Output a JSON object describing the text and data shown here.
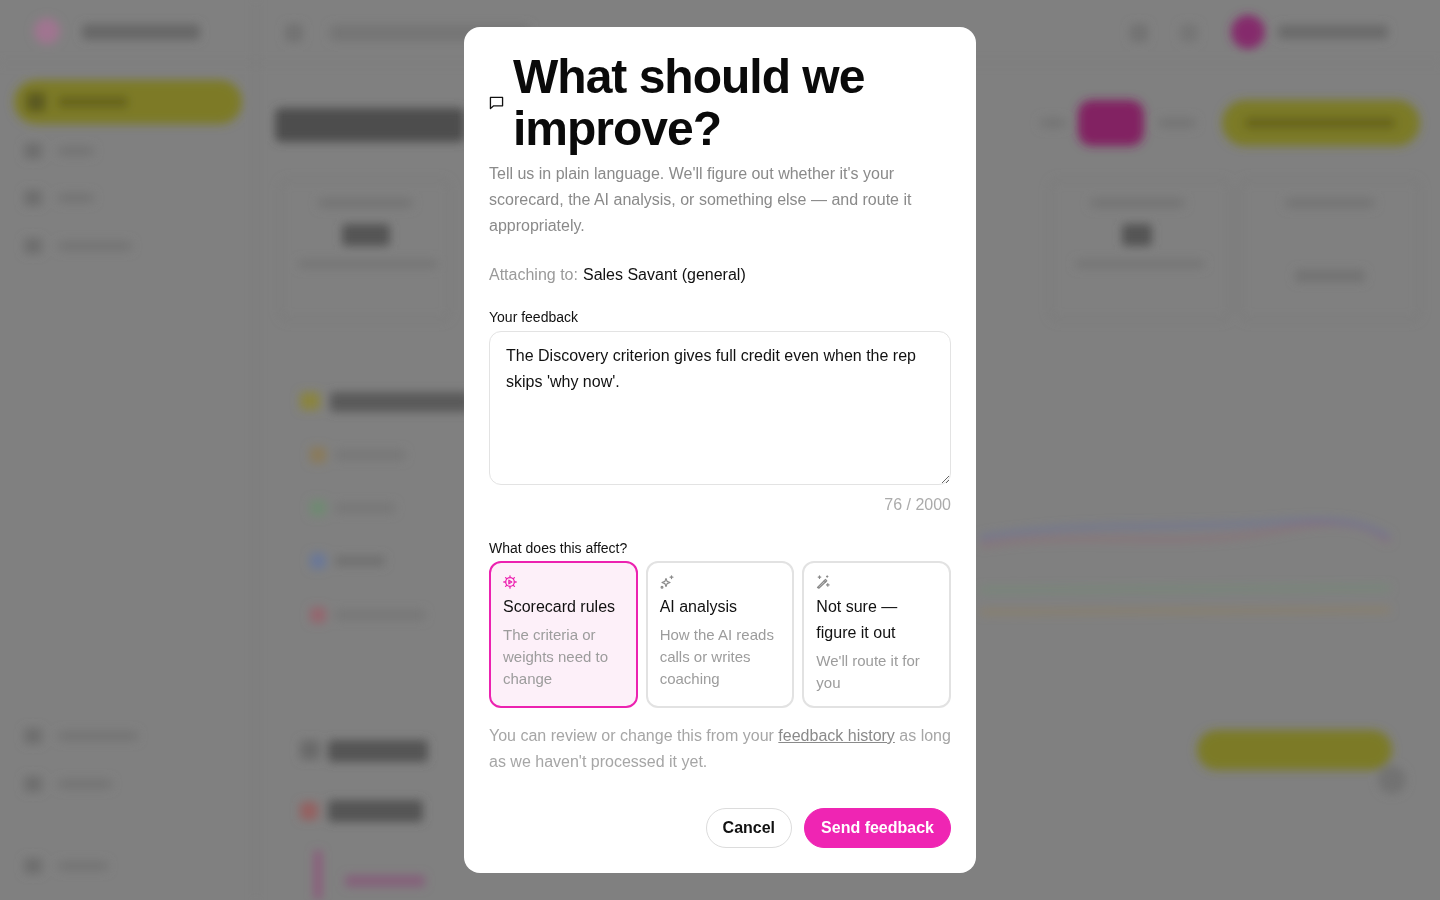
{
  "dialog": {
    "title": "What should we improve?",
    "description": "Tell us in plain language. We'll figure out whether it's your scorecard, the AI analysis, or something else — and route it appropriately.",
    "attachment": {
      "label": "Attaching to:",
      "value": "Sales Savant (general)"
    },
    "feedback_field": {
      "label": "Your feedback",
      "value": "The Discovery criterion gives full credit even when the rep skips 'why now'.",
      "counter": "76 / 2000"
    },
    "affect": {
      "label": "What does this affect?",
      "options": [
        {
          "kind": "scorecard",
          "title": "Scorecard rules",
          "description": "The criteria or weights need to change",
          "selected": true
        },
        {
          "kind": "ai",
          "title": "AI analysis",
          "description": "How the AI reads calls or writes coaching",
          "selected": false
        },
        {
          "kind": "unsure",
          "title": "Not sure — figure it out",
          "description": "We'll route it for you",
          "selected": false
        }
      ]
    },
    "note": {
      "text_before": "You can review or change this from your",
      "link": "feedback history",
      "text_after": "as long as we haven't processed it yet."
    },
    "buttons": [
      {
        "kind": "secondary",
        "label": "Cancel"
      },
      {
        "kind": "primary",
        "label": "Send feedback"
      }
    ]
  }
}
